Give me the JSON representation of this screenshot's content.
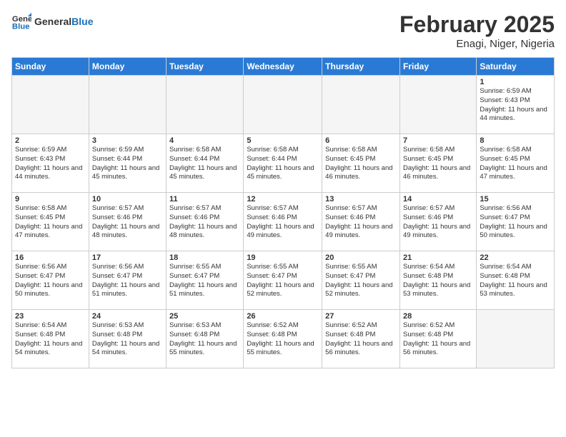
{
  "header": {
    "logo_general": "General",
    "logo_blue": "Blue",
    "title": "February 2025",
    "subtitle": "Enagi, Niger, Nigeria"
  },
  "calendar": {
    "days_of_week": [
      "Sunday",
      "Monday",
      "Tuesday",
      "Wednesday",
      "Thursday",
      "Friday",
      "Saturday"
    ],
    "weeks": [
      [
        {
          "day": "",
          "empty": true
        },
        {
          "day": "",
          "empty": true
        },
        {
          "day": "",
          "empty": true
        },
        {
          "day": "",
          "empty": true
        },
        {
          "day": "",
          "empty": true
        },
        {
          "day": "",
          "empty": true
        },
        {
          "day": "1",
          "sunrise": "6:59 AM",
          "sunset": "6:43 PM",
          "daylight": "11 hours and 44 minutes."
        }
      ],
      [
        {
          "day": "2",
          "sunrise": "6:59 AM",
          "sunset": "6:43 PM",
          "daylight": "11 hours and 44 minutes."
        },
        {
          "day": "3",
          "sunrise": "6:59 AM",
          "sunset": "6:44 PM",
          "daylight": "11 hours and 45 minutes."
        },
        {
          "day": "4",
          "sunrise": "6:58 AM",
          "sunset": "6:44 PM",
          "daylight": "11 hours and 45 minutes."
        },
        {
          "day": "5",
          "sunrise": "6:58 AM",
          "sunset": "6:44 PM",
          "daylight": "11 hours and 45 minutes."
        },
        {
          "day": "6",
          "sunrise": "6:58 AM",
          "sunset": "6:45 PM",
          "daylight": "11 hours and 46 minutes."
        },
        {
          "day": "7",
          "sunrise": "6:58 AM",
          "sunset": "6:45 PM",
          "daylight": "11 hours and 46 minutes."
        },
        {
          "day": "8",
          "sunrise": "6:58 AM",
          "sunset": "6:45 PM",
          "daylight": "11 hours and 47 minutes."
        }
      ],
      [
        {
          "day": "9",
          "sunrise": "6:58 AM",
          "sunset": "6:45 PM",
          "daylight": "11 hours and 47 minutes."
        },
        {
          "day": "10",
          "sunrise": "6:57 AM",
          "sunset": "6:46 PM",
          "daylight": "11 hours and 48 minutes."
        },
        {
          "day": "11",
          "sunrise": "6:57 AM",
          "sunset": "6:46 PM",
          "daylight": "11 hours and 48 minutes."
        },
        {
          "day": "12",
          "sunrise": "6:57 AM",
          "sunset": "6:46 PM",
          "daylight": "11 hours and 49 minutes."
        },
        {
          "day": "13",
          "sunrise": "6:57 AM",
          "sunset": "6:46 PM",
          "daylight": "11 hours and 49 minutes."
        },
        {
          "day": "14",
          "sunrise": "6:57 AM",
          "sunset": "6:46 PM",
          "daylight": "11 hours and 49 minutes."
        },
        {
          "day": "15",
          "sunrise": "6:56 AM",
          "sunset": "6:47 PM",
          "daylight": "11 hours and 50 minutes."
        }
      ],
      [
        {
          "day": "16",
          "sunrise": "6:56 AM",
          "sunset": "6:47 PM",
          "daylight": "11 hours and 50 minutes."
        },
        {
          "day": "17",
          "sunrise": "6:56 AM",
          "sunset": "6:47 PM",
          "daylight": "11 hours and 51 minutes."
        },
        {
          "day": "18",
          "sunrise": "6:55 AM",
          "sunset": "6:47 PM",
          "daylight": "11 hours and 51 minutes."
        },
        {
          "day": "19",
          "sunrise": "6:55 AM",
          "sunset": "6:47 PM",
          "daylight": "11 hours and 52 minutes."
        },
        {
          "day": "20",
          "sunrise": "6:55 AM",
          "sunset": "6:47 PM",
          "daylight": "11 hours and 52 minutes."
        },
        {
          "day": "21",
          "sunrise": "6:54 AM",
          "sunset": "6:48 PM",
          "daylight": "11 hours and 53 minutes."
        },
        {
          "day": "22",
          "sunrise": "6:54 AM",
          "sunset": "6:48 PM",
          "daylight": "11 hours and 53 minutes."
        }
      ],
      [
        {
          "day": "23",
          "sunrise": "6:54 AM",
          "sunset": "6:48 PM",
          "daylight": "11 hours and 54 minutes."
        },
        {
          "day": "24",
          "sunrise": "6:53 AM",
          "sunset": "6:48 PM",
          "daylight": "11 hours and 54 minutes."
        },
        {
          "day": "25",
          "sunrise": "6:53 AM",
          "sunset": "6:48 PM",
          "daylight": "11 hours and 55 minutes."
        },
        {
          "day": "26",
          "sunrise": "6:52 AM",
          "sunset": "6:48 PM",
          "daylight": "11 hours and 55 minutes."
        },
        {
          "day": "27",
          "sunrise": "6:52 AM",
          "sunset": "6:48 PM",
          "daylight": "11 hours and 56 minutes."
        },
        {
          "day": "28",
          "sunrise": "6:52 AM",
          "sunset": "6:48 PM",
          "daylight": "11 hours and 56 minutes."
        },
        {
          "day": "",
          "empty": true
        }
      ]
    ]
  }
}
